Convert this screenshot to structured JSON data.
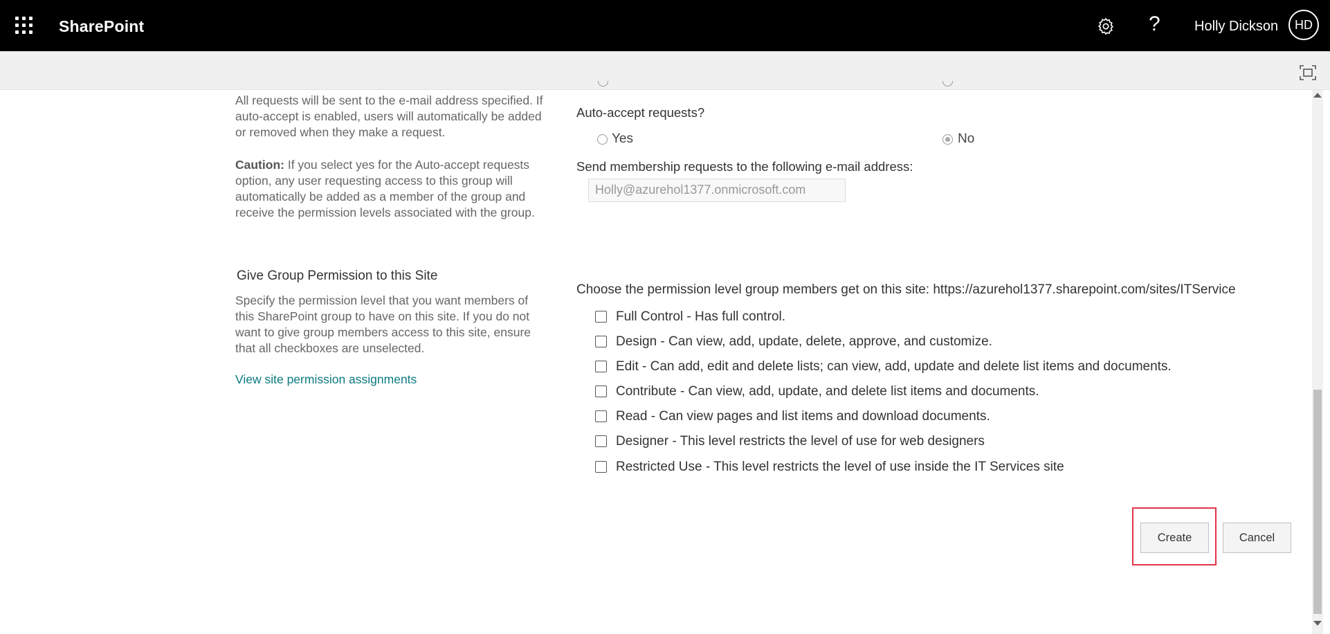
{
  "header": {
    "brand": "SharePoint",
    "user_name": "Holly Dickson",
    "user_initials": "HD",
    "help_glyph": "?"
  },
  "membership": {
    "desc_line1": "All requests will be sent to the e-mail address specified. If auto-accept is enabled, users will automatically be added or removed when they make a request.",
    "caution_bold": "Caution:",
    "caution_text": " If you select yes for the Auto-accept requests option, any user requesting access to this group will automatically be added as a member of the group and receive the permission levels associated with the group.",
    "auto_accept_label": "Auto-accept requests?",
    "yes_label": "Yes",
    "no_label": "No",
    "selected": "No",
    "email_label": "Send membership requests to the following e-mail address:",
    "email_value": "Holly@azurehol1377.onmicrosoft.com"
  },
  "permission": {
    "title": "Give Group Permission to this Site",
    "desc": "Specify the permission level that you want members of this SharePoint group to have on this site. If you do not want to give group members access to this site, ensure that all checkboxes are unselected.",
    "link": "View site permission assignments",
    "header": "Choose the permission level group members get on this site: https://azurehol1377.sharepoint.com/sites/ITService",
    "levels": [
      "Full Control - Has full control.",
      "Design - Can view, add, update, delete, approve, and customize.",
      "Edit - Can add, edit and delete lists; can view, add, update and delete list items and documents.",
      "Contribute - Can view, add, update, and delete list items and documents.",
      "Read - Can view pages and list items and download documents.",
      "Designer - This level restricts the level of use for web designers",
      "Restricted Use - This level restricts the level of use inside the IT Services site"
    ]
  },
  "buttons": {
    "create": "Create",
    "cancel": "Cancel"
  },
  "colors": {
    "link": "#0b7a80",
    "highlight": "#e0334a"
  }
}
